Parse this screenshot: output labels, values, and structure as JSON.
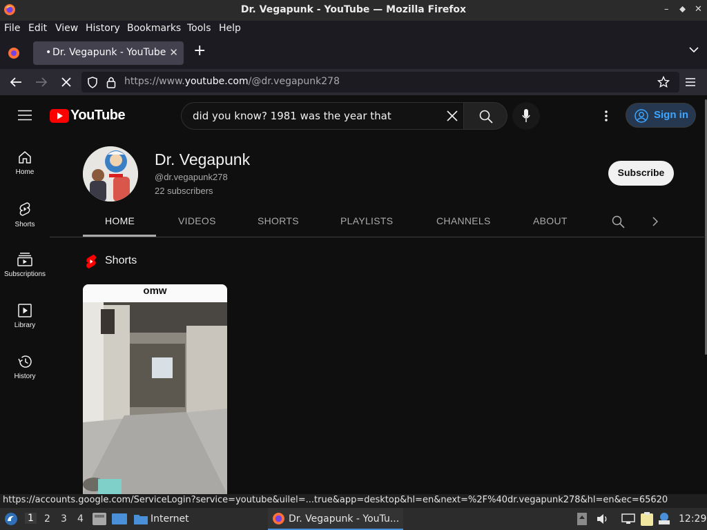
{
  "window": {
    "title": "Dr. Vegapunk - YouTube — Mozilla Firefox",
    "controls": [
      "–",
      "⬥",
      "✕"
    ]
  },
  "menu": [
    "File",
    "Edit",
    "View",
    "History",
    "Bookmarks",
    "Tools",
    "Help"
  ],
  "tab": {
    "title": "Dr. Vegapunk - YouTube",
    "dot": "•"
  },
  "address": {
    "prefix": "https://www.",
    "domain": "youtube.com",
    "path": "/@dr.vegapunk278"
  },
  "youtube": {
    "logo_text": "YouTube",
    "search_value": "did you know? 1981 was the year that",
    "signin": "Sign in",
    "sidebar": [
      {
        "label": "Home",
        "icon": "home-icon"
      },
      {
        "label": "Shorts",
        "icon": "shorts-icon"
      },
      {
        "label": "Subscriptions",
        "icon": "subscriptions-icon"
      },
      {
        "label": "Library",
        "icon": "library-icon"
      },
      {
        "label": "History",
        "icon": "history-icon"
      }
    ],
    "channel": {
      "name": "Dr. Vegapunk",
      "handle": "@dr.vegapunk278",
      "subscribers": "22 subscribers",
      "subscribe": "Subscribe"
    },
    "tabs": [
      "HOME",
      "VIDEOS",
      "SHORTS",
      "PLAYLISTS",
      "CHANNELS",
      "ABOUT"
    ],
    "shorts_heading": "Shorts",
    "short_caption": "omw"
  },
  "status_url": "https://accounts.google.com/ServiceLogin?service=youtube&uilel=...true&app=desktop&hl=en&next=%2F%40dr.vegapunk278&hl=en&ec=65620",
  "taskbar": {
    "workspaces": [
      "1",
      "2",
      "3",
      "4"
    ],
    "launcher_label": "Internet",
    "task_title": "Dr. Vegapunk - YouTu...",
    "clock": "12:29"
  },
  "colors": {
    "youtube_red": "#ff0000",
    "signin_blue": "#3ea6ff",
    "firefox_orange": "#ff7139"
  }
}
